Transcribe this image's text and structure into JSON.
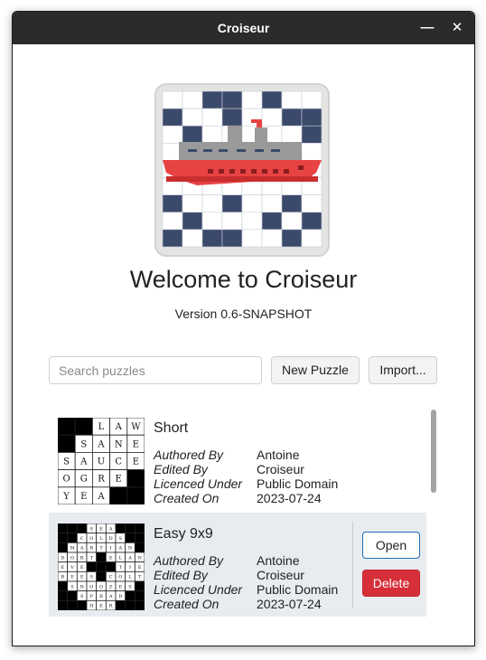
{
  "window": {
    "title": "Croiseur",
    "minimize_glyph": "—",
    "close_glyph": "✕"
  },
  "welcome": {
    "heading": "Welcome to Croiseur",
    "version": "Version 0.6-SNAPSHOT"
  },
  "toolbar": {
    "search_placeholder": "Search puzzles",
    "search_value": "",
    "new_puzzle_label": "New Puzzle",
    "import_label": "Import..."
  },
  "meta_keys": {
    "author": "Authored By",
    "editor": "Edited By",
    "licence": "Licenced Under",
    "created": "Created On"
  },
  "puzzles": [
    {
      "title": "Short",
      "author": "Antoine",
      "editor": "Croiseur",
      "licence": "Public Domain",
      "created": "2023-07-24",
      "grid": [
        "##LAW",
        "#SANE",
        "SAUCE",
        "OGRE#",
        "YEA##"
      ]
    },
    {
      "title": "Easy 9x9",
      "author": "Antoine",
      "editor": "Croiseur",
      "licence": "Public Domain",
      "created": "2023-07-24",
      "open_label": "Open",
      "delete_label": "Delete",
      "grid": [
        "###SEA###",
        "##COLDS##",
        "#MARTIAN#",
        "DORT#ELAN",
        "EVE###TIE",
        "BEES#COLT",
        "#SNOOZES#",
        "##SPRAD##",
        "###HER###"
      ]
    }
  ],
  "colors": {
    "titlebar": "#2b2b2b",
    "accent": "#1c6db6",
    "delete": "#d62f3a",
    "selected_row": "#e8ebef",
    "logo_block": "#3b4a6b",
    "ship_red": "#e84343",
    "ship_gray": "#9a9a9a"
  }
}
